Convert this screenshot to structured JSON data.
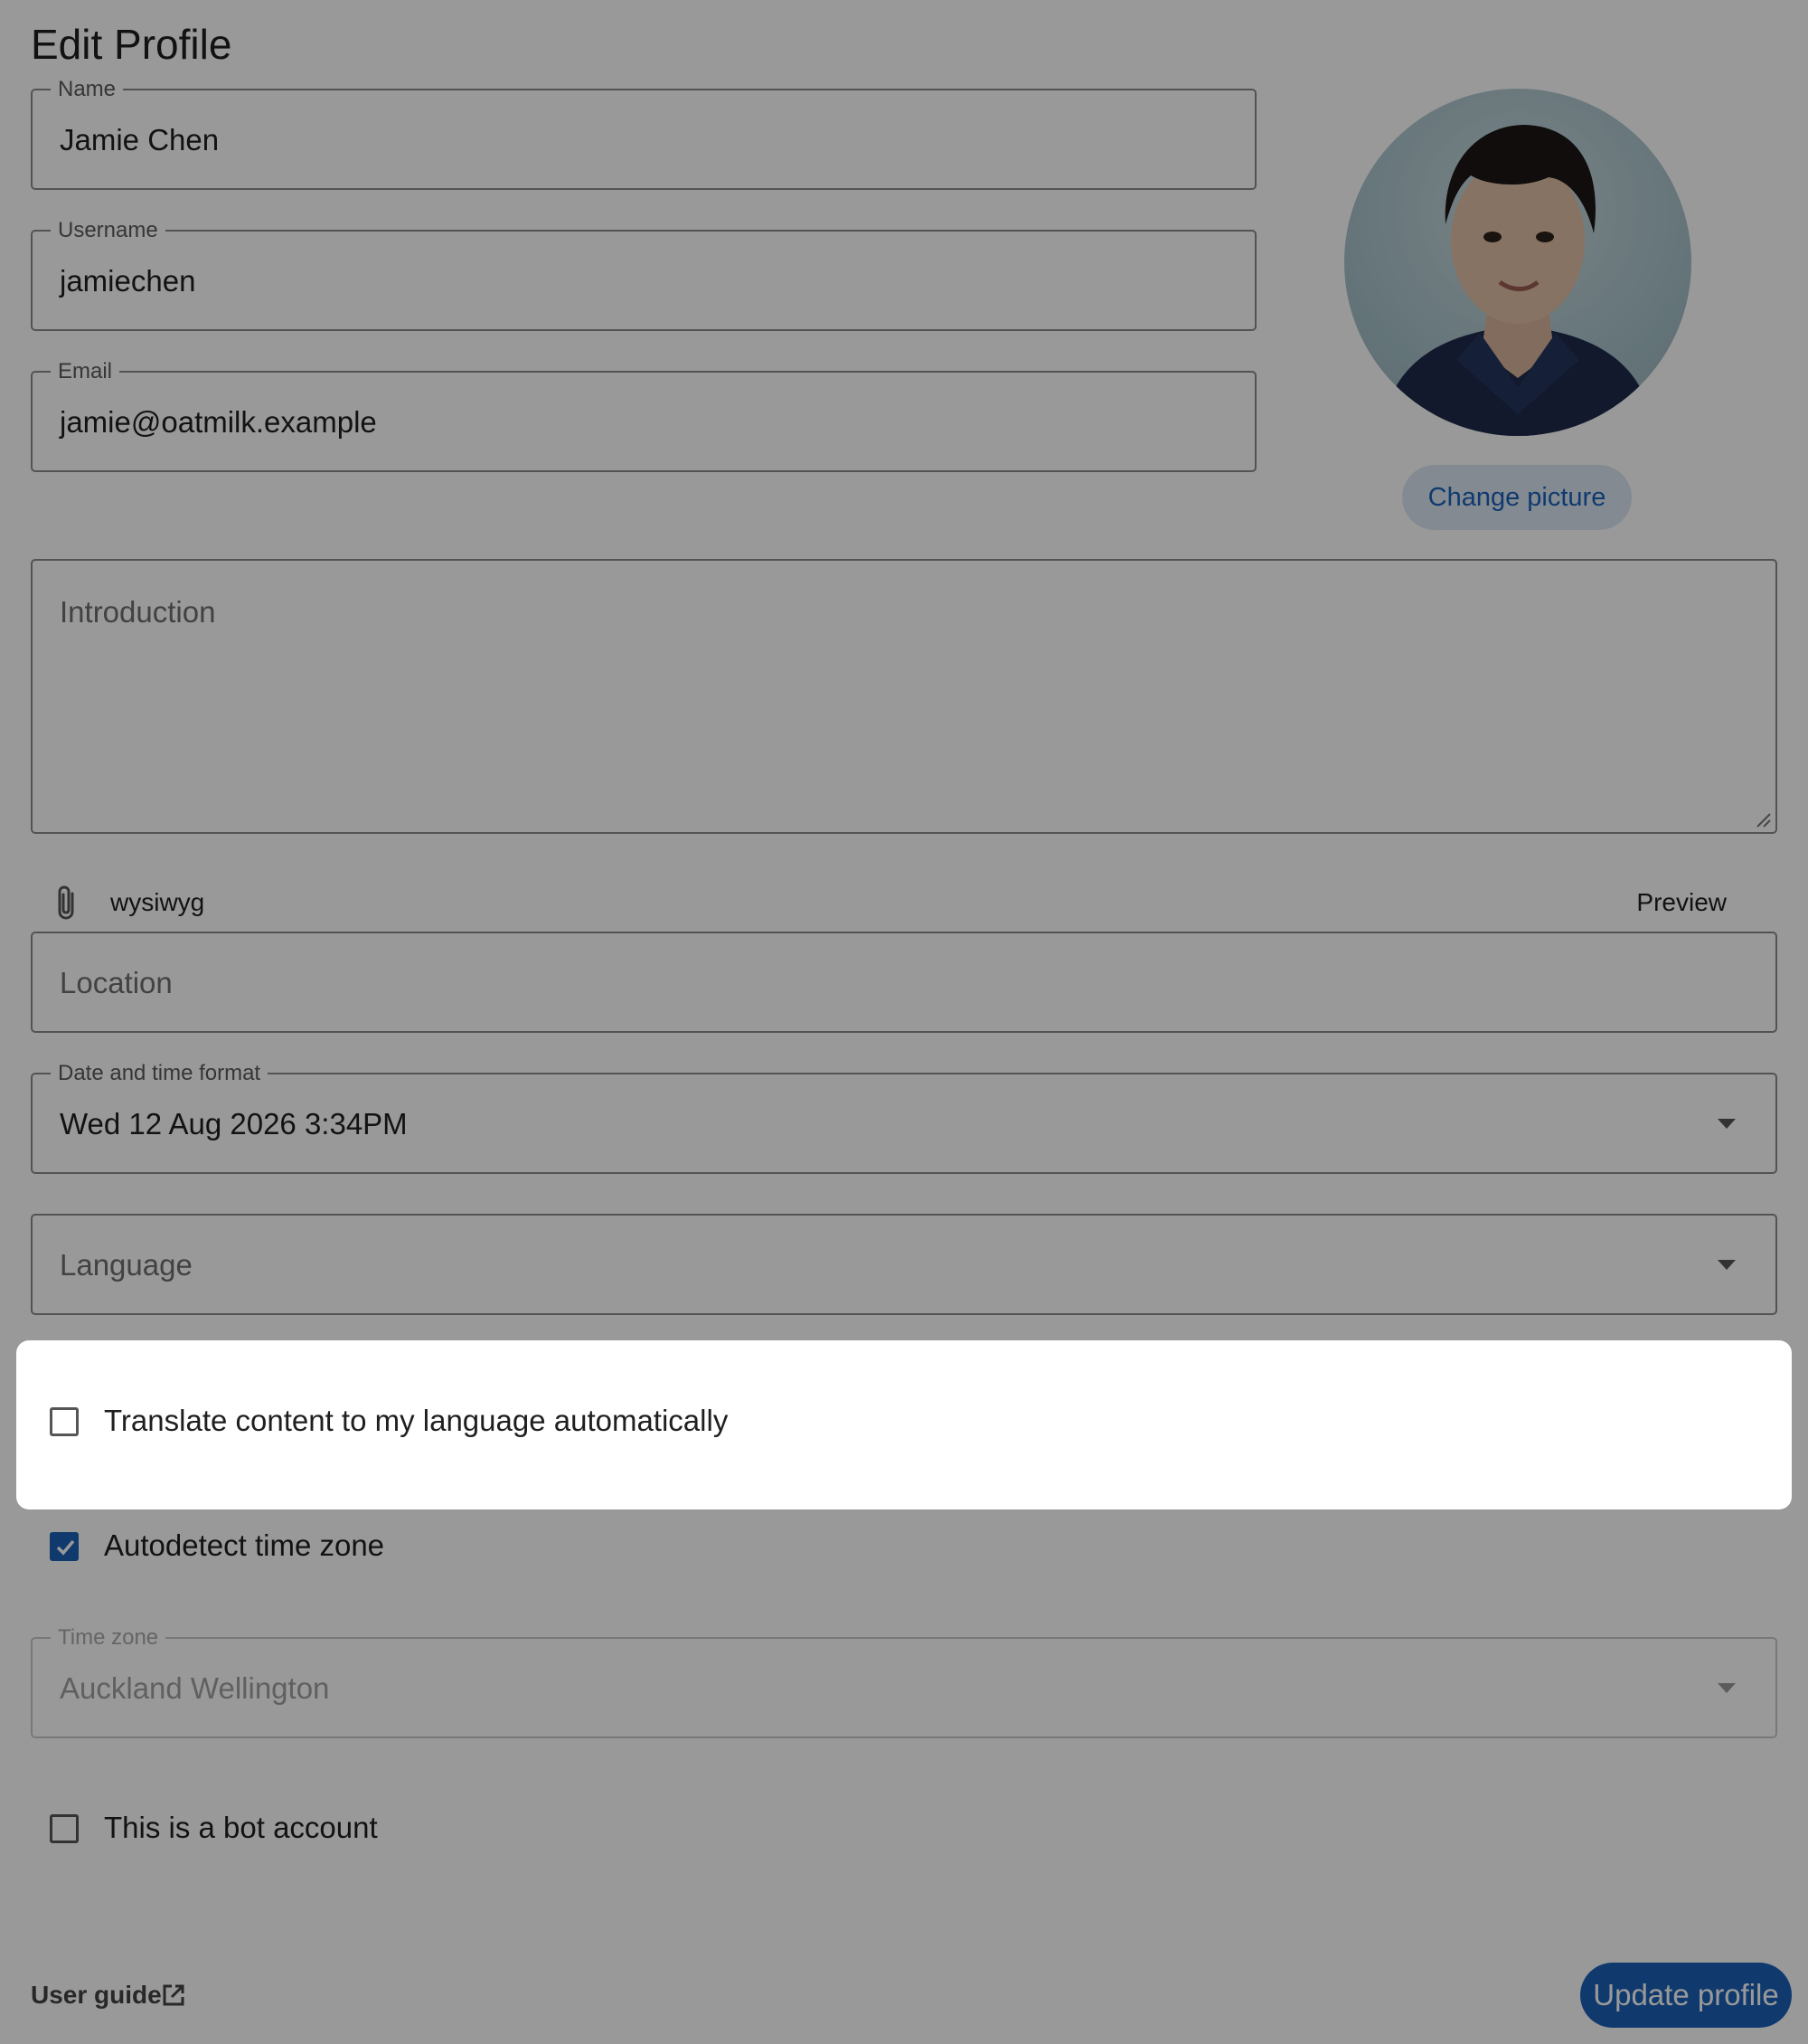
{
  "page": {
    "title": "Edit Profile"
  },
  "fields": {
    "name": {
      "label": "Name",
      "value": "Jamie Chen"
    },
    "username": {
      "label": "Username",
      "value": "jamiechen"
    },
    "email": {
      "label": "Email",
      "value": "jamie@oatmilk.example"
    },
    "introduction": {
      "placeholder": "Introduction"
    },
    "location": {
      "placeholder": "Location"
    },
    "datetime_format": {
      "label": "Date and time format",
      "value": "Wed 12 Aug 2026 3:34PM"
    },
    "language": {
      "placeholder": "Language"
    },
    "time_zone": {
      "label": "Time zone",
      "value": "Auckland Wellington"
    }
  },
  "avatar": {
    "change_label": "Change picture"
  },
  "editor_toolbar": {
    "attach_icon": "paperclip-icon",
    "mode_label": "wysiwyg",
    "preview_label": "Preview"
  },
  "checkboxes": {
    "translate": {
      "label": "Translate content to my language automatically",
      "checked": false
    },
    "autodetect_tz": {
      "label": "Autodetect time zone",
      "checked": true
    },
    "bot_account": {
      "label": "This is a bot account",
      "checked": false
    }
  },
  "footer": {
    "user_guide_label": "User guide",
    "user_guide_icon": "external-link-icon",
    "update_label": "Update profile"
  },
  "colors": {
    "accent": "#1b62b8",
    "overlay": "rgba(0,0,0,0.40)",
    "highlight": "#ffffff"
  }
}
